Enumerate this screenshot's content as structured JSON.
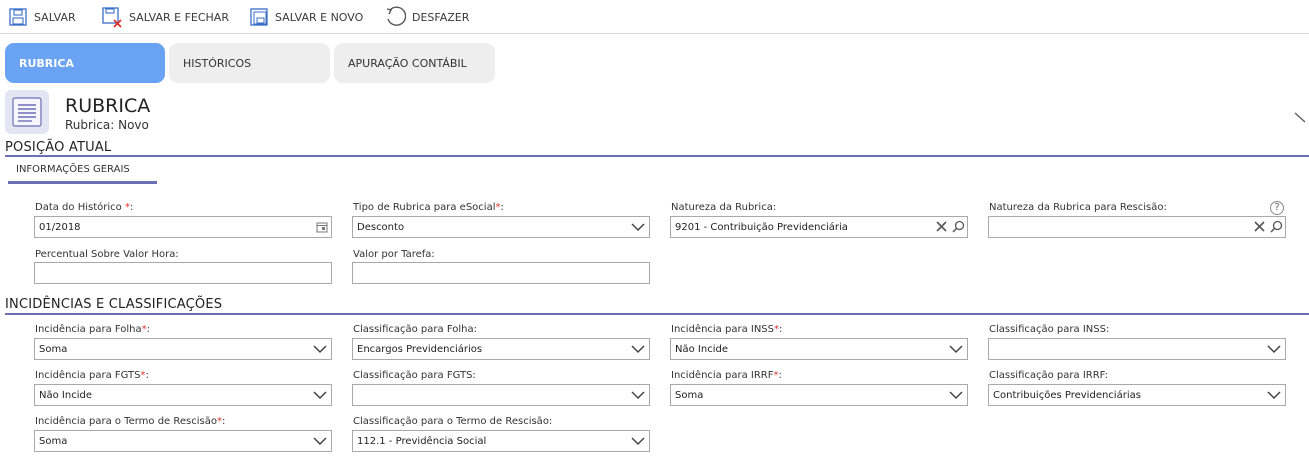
{
  "toolbar": {
    "save_label": "SALVAR",
    "save_close_label": "SALVAR E FECHAR",
    "save_new_label": "SALVAR E NOVO",
    "undo_label": "DESFAZER"
  },
  "tabs": [
    {
      "label": "RUBRICA",
      "active": true
    },
    {
      "label": "HISTÓRICOS",
      "active": false
    },
    {
      "label": "APURAÇÃO CONTÁBIL",
      "active": false
    }
  ],
  "header": {
    "title": "RUBRICA",
    "subtitle": "Rubrica: Novo"
  },
  "sections": {
    "current_position": "POSIÇÃO ATUAL",
    "general_info_tab": "INFORMAÇÕES GERAIS",
    "incidences": "INCIDÊNCIAS E CLASSIFICAÇÕES"
  },
  "fields": {
    "history_date": {
      "label": "Data do Histórico ",
      "required": "*",
      "suffix": ":",
      "value": "01/2018"
    },
    "esocial_type": {
      "label": "Tipo de Rubrica para eSocial",
      "required": "*",
      "suffix": ":",
      "value": "Desconto"
    },
    "nature": {
      "label": "Natureza da Rubrica:",
      "value": "9201 - Contribuição Previdenciária"
    },
    "nature_rescission": {
      "label": "Natureza da Rubrica para Rescisão:",
      "value": ""
    },
    "percent_hour": {
      "label": "Percentual Sobre Valor Hora:",
      "value": ""
    },
    "task_value": {
      "label": "Valor por Tarefa:",
      "value": ""
    },
    "inc_payroll": {
      "label": "Incidência para Folha",
      "required": "*",
      "suffix": ":",
      "value": "Soma"
    },
    "class_payroll": {
      "label": "Classificação para Folha:",
      "value": "Encargos Previdenciários"
    },
    "inc_inss": {
      "label": "Incidência para INSS",
      "required": "*",
      "suffix": ":",
      "value": "Não Incide"
    },
    "class_inss": {
      "label": "Classificação para INSS:",
      "value": ""
    },
    "inc_fgts": {
      "label": "Incidência para FGTS",
      "required": "*",
      "suffix": ":",
      "value": "Não Incide"
    },
    "class_fgts": {
      "label": "Classificação para FGTS:",
      "value": ""
    },
    "inc_irrf": {
      "label": "Incidência para IRRF",
      "required": "*",
      "suffix": ":",
      "value": "Soma"
    },
    "class_irrf": {
      "label": "Classificação para IRRF:",
      "value": "Contribuições Previdenciárias"
    },
    "inc_rescission": {
      "label": "Incidência para o Termo de Rescisão",
      "required": "*",
      "suffix": ":",
      "value": "Soma"
    },
    "class_rescission": {
      "label": "Classificação para o Termo de Rescisão:",
      "value": "112.1 - Previdência Social"
    }
  },
  "help_label": "?",
  "colors": {
    "tab_active": "#6aa3f3",
    "section_line": "#6b6fb5",
    "required": "#e0332b"
  }
}
